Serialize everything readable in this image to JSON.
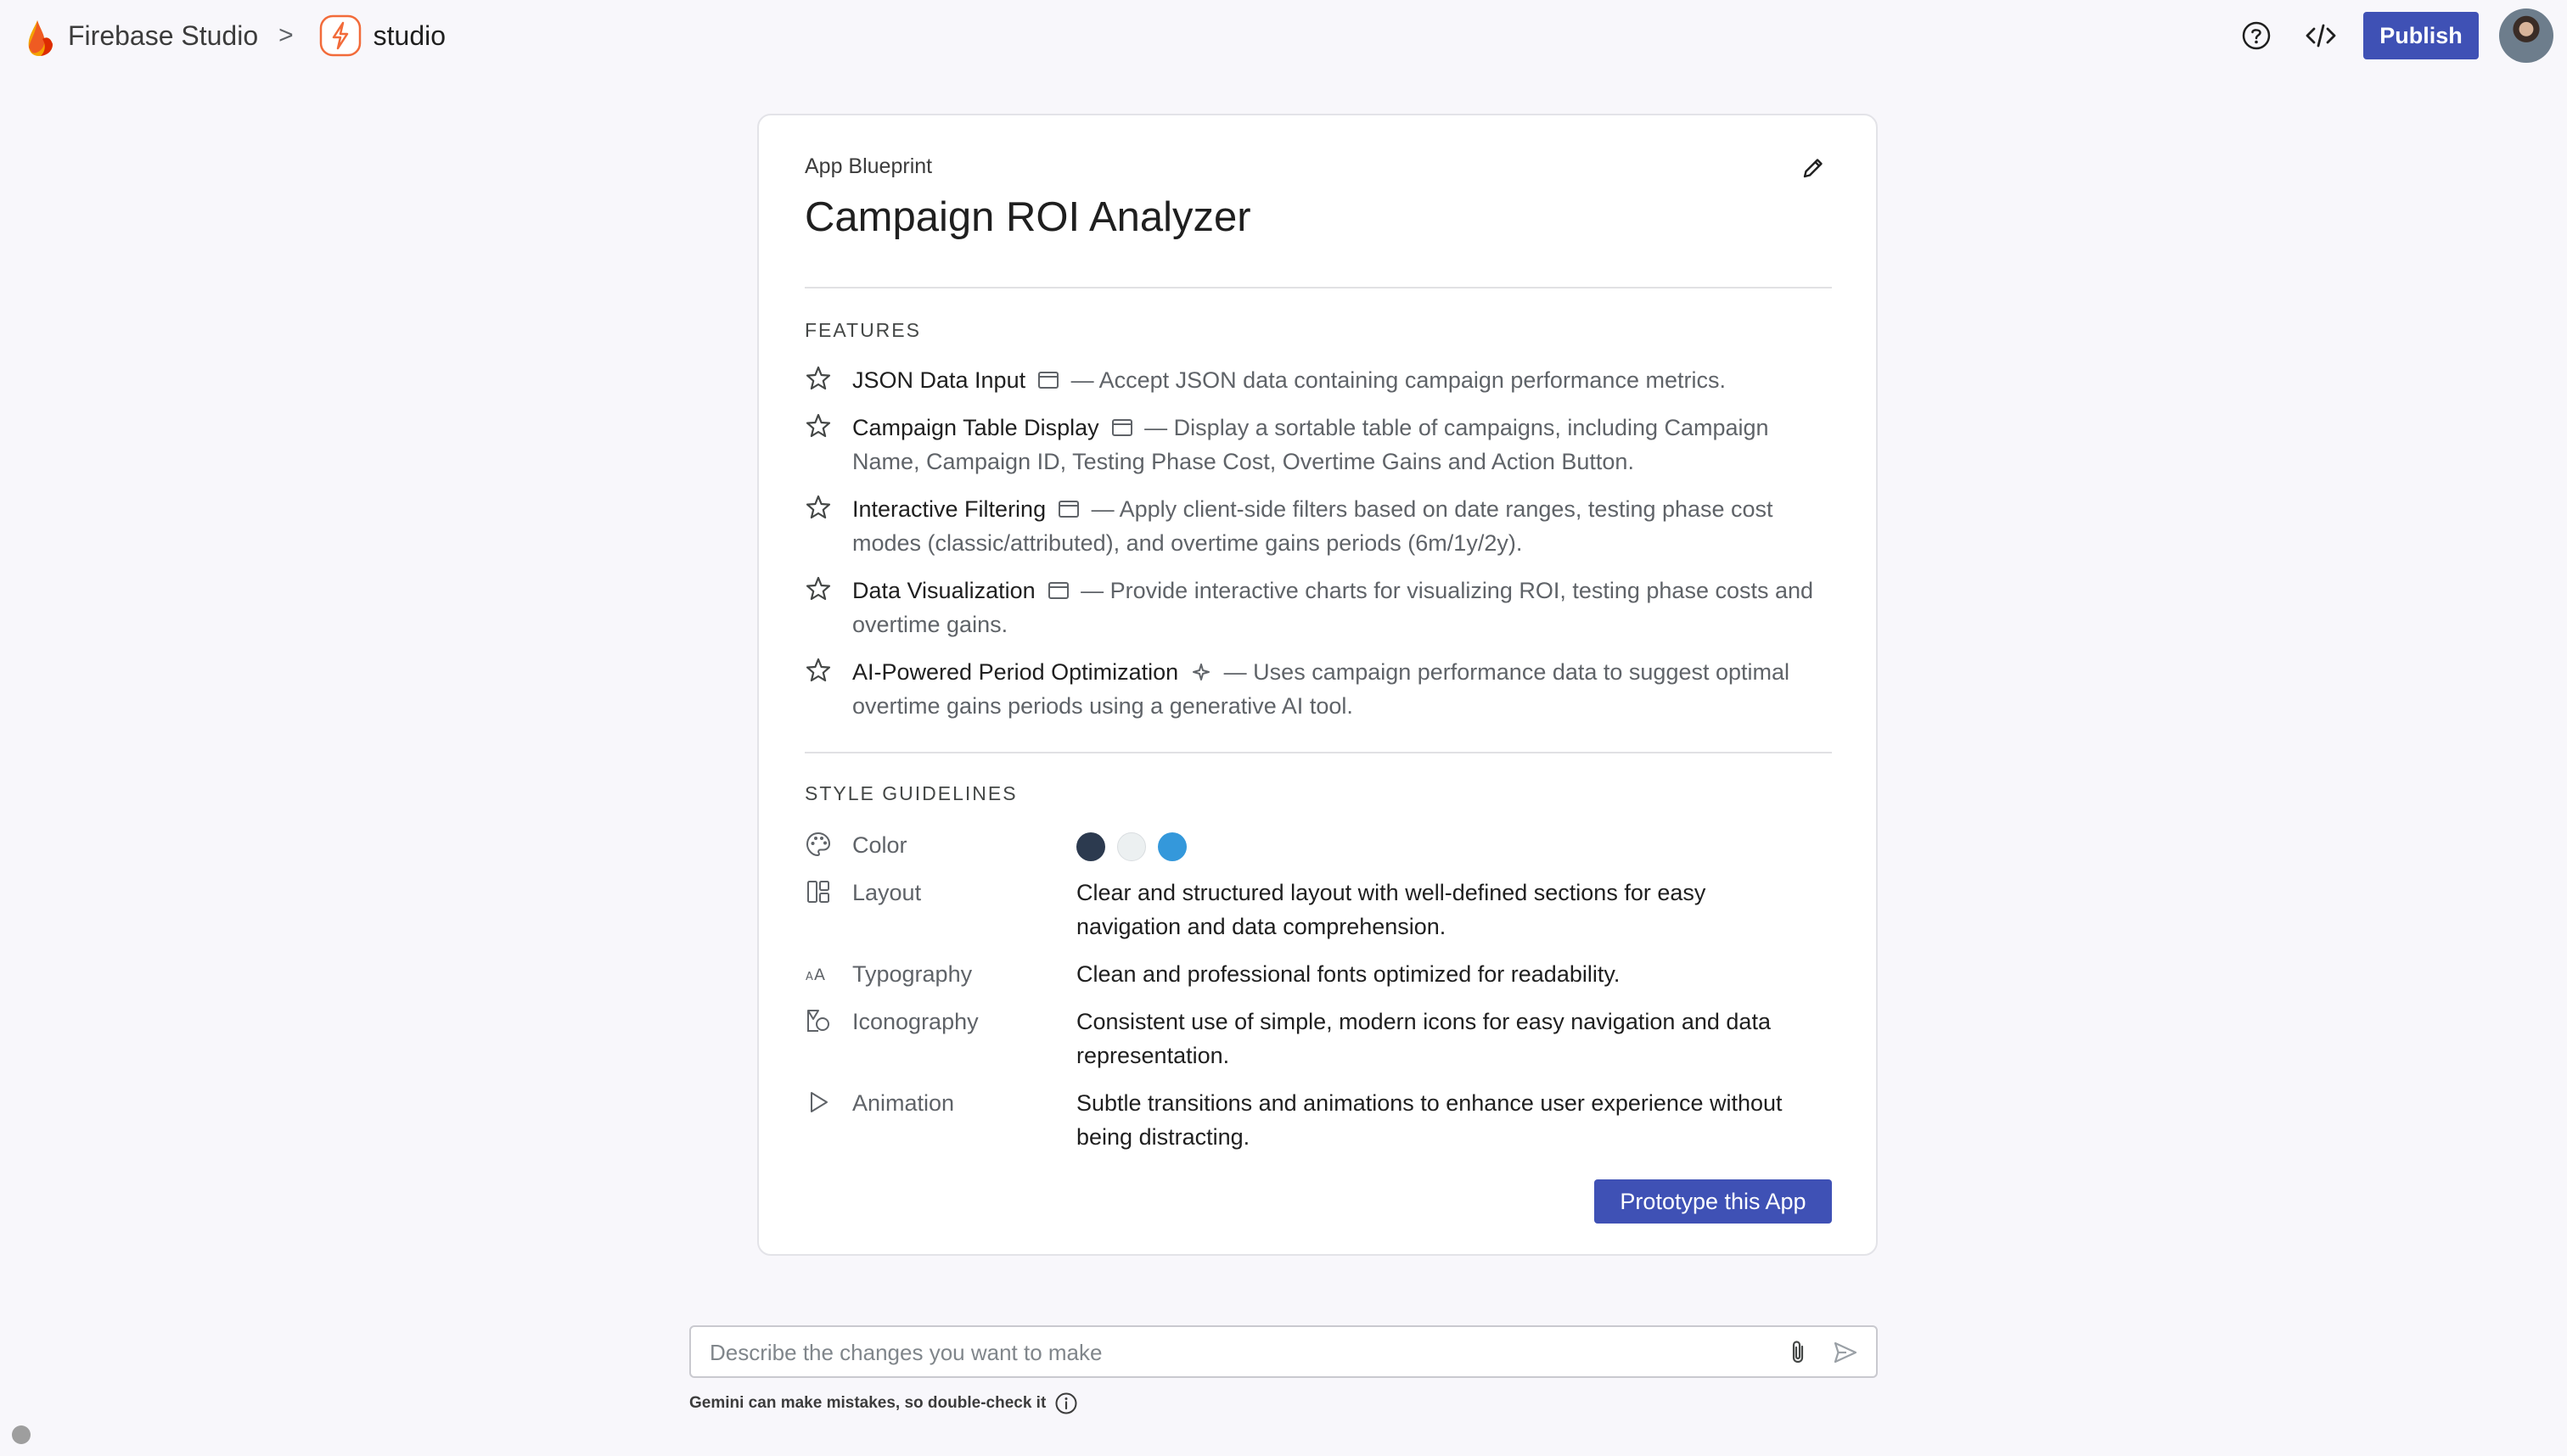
{
  "header": {
    "brand_name": "Firebase Studio",
    "separator": ">",
    "project_name": "studio",
    "publish_label": "Publish"
  },
  "card": {
    "label": "App Blueprint",
    "title": "Campaign ROI Analyzer",
    "features_title": "FEATURES",
    "features": [
      {
        "name": "JSON Data Input",
        "type_icon": "window-icon",
        "line1": " — Accept JSON data containing campaign performance metrics.",
        "line2": ""
      },
      {
        "name": "Campaign Table Display",
        "type_icon": "window-icon",
        "line1": " — Display a sortable table of campaigns, including Campaign",
        "line2": "Name, Campaign ID, Testing Phase Cost, Overtime Gains and Action Button."
      },
      {
        "name": "Interactive Filtering",
        "type_icon": "window-icon",
        "line1": " — Apply client-side filters based on date ranges, testing phase cost",
        "line2": "modes (classic/attributed), and overtime gains periods (6m/1y/2y)."
      },
      {
        "name": "Data Visualization",
        "type_icon": "window-icon",
        "line1": " — Provide interactive charts for visualizing ROI, testing phase costs and",
        "line2": "overtime gains."
      },
      {
        "name": "AI-Powered Period Optimization",
        "type_icon": "sparkle-icon",
        "line1": " — Uses campaign performance data to suggest optimal",
        "line2": "overtime gains periods using a generative AI tool."
      }
    ],
    "style_title": "STYLE GUIDELINES",
    "style": {
      "color": {
        "label": "Color",
        "swatches": [
          "#2c3a4f",
          "#ecf0f1",
          "#3498db"
        ]
      },
      "layout": {
        "label": "Layout",
        "line1": "Clear and structured layout with well-defined sections for easy",
        "line2": "navigation and data comprehension."
      },
      "typography": {
        "label": "Typography",
        "line1": "Clean and professional fonts optimized for readability.",
        "line2": ""
      },
      "iconography": {
        "label": "Iconography",
        "line1": "Consistent use of simple, modern icons for easy navigation and data",
        "line2": "representation."
      },
      "animation": {
        "label": "Animation",
        "line1": "Subtle transitions and animations to enhance user experience without",
        "line2": "being distracting."
      }
    },
    "prototype_label": "Prototype this App"
  },
  "prompt": {
    "placeholder": "Describe the changes you want to make",
    "value": ""
  },
  "disclaimer": "Gemini can make mistakes, so double-check it",
  "colors": {
    "accent": "#3f51b5",
    "background": "#f8f7fb"
  }
}
